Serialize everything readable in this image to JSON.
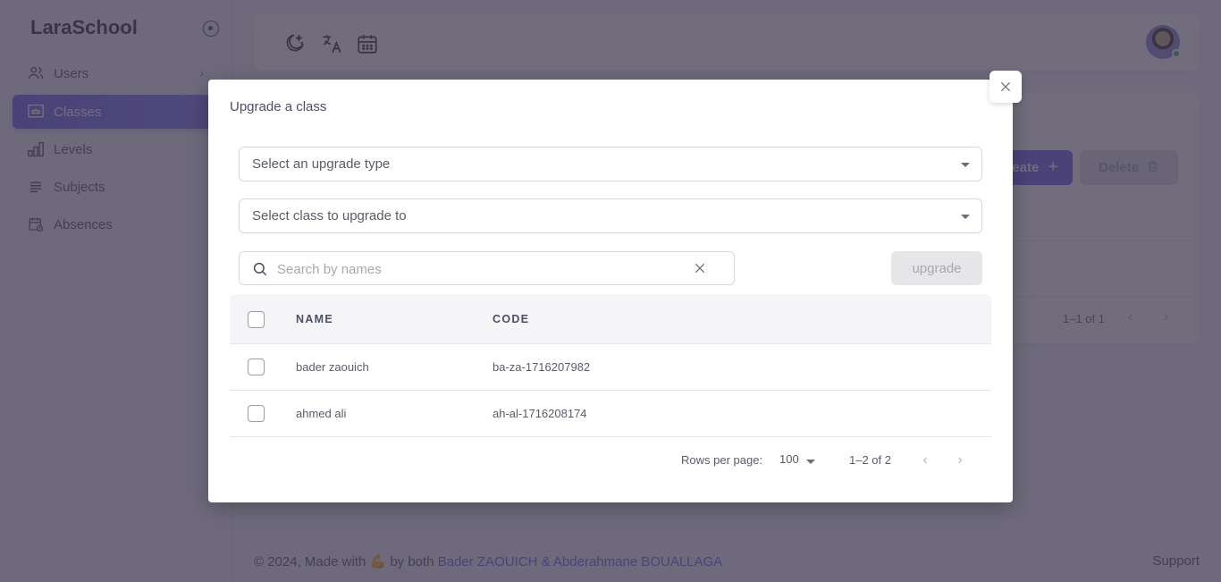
{
  "app": {
    "brand": "LaraSchool"
  },
  "sidebar": {
    "items": [
      {
        "label": "Users",
        "icon": "users-icon",
        "has_submenu": true
      },
      {
        "label": "Classes",
        "icon": "classes-icon",
        "active": true
      },
      {
        "label": "Levels",
        "icon": "bar-chart-icon"
      },
      {
        "label": "Subjects",
        "icon": "list-icon"
      },
      {
        "label": "Absences",
        "icon": "calendar-clock-icon"
      }
    ]
  },
  "topbar": {
    "icons": [
      "moon-stars-icon",
      "translate-icon",
      "calendar-icon"
    ],
    "avatar_status": "online",
    "status_color": "#28c76f"
  },
  "background_card": {
    "create_label": "Create",
    "delete_label": "Delete",
    "pagination_text": "1–1 of 1"
  },
  "modal": {
    "title": "Upgrade a class",
    "upgrade_type_placeholder": "Select an upgrade type",
    "target_class_placeholder": "Select class to upgrade to",
    "search_placeholder": "Search by names",
    "search_value": "",
    "upgrade_button": "upgrade",
    "table": {
      "columns": [
        "NAME",
        "CODE"
      ],
      "rows": [
        {
          "name": "bader zaouich",
          "code": "ba-za-1716207982",
          "selected": false
        },
        {
          "name": "ahmed ali",
          "code": "ah-al-1716208174",
          "selected": false
        }
      ]
    },
    "pagination": {
      "rows_per_page_label": "Rows per page:",
      "rows_per_page": "100",
      "range_text": "1–2 of 2"
    }
  },
  "footer": {
    "prefix": "© 2024, Made with",
    "emoji": "💪",
    "middle": "by both",
    "authors": "Bader ZAOUICH & Abderahmane BOUALLAGA",
    "support": "Support"
  },
  "colors": {
    "primary": "#7367f0",
    "success": "#28c76f"
  }
}
